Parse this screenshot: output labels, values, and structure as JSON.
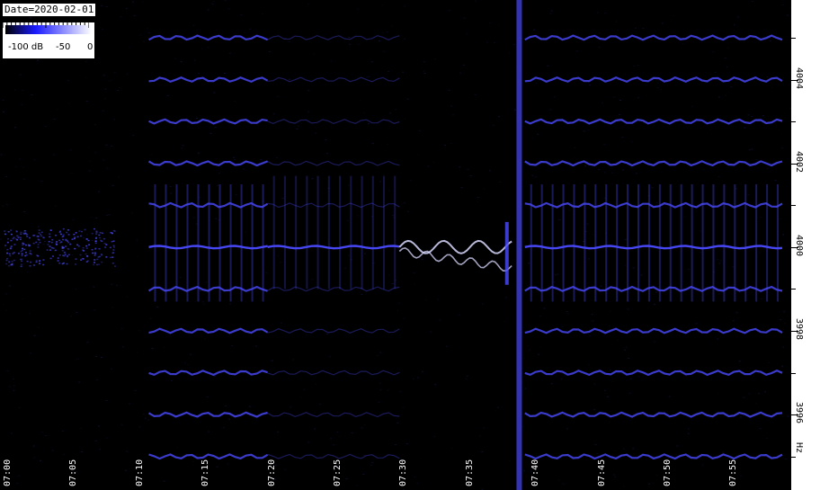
{
  "date_label": "Date=2020-02-01",
  "legend": {
    "min_label": "-100 dB",
    "mid_label": "-50",
    "max_label": "0",
    "colors": [
      "#000000",
      "#1a1aff",
      "#ffffff"
    ]
  },
  "y_unit": "Hz",
  "colors": {
    "background": "#000000",
    "signal": "#4a4aff",
    "bright": "#d8d8ff"
  },
  "chart_data": {
    "type": "heatmap",
    "title": "",
    "xlabel": "",
    "ylabel": "Hz",
    "x_ticks": [
      "07:00",
      "07:05",
      "07:10",
      "07:15",
      "07:20",
      "07:25",
      "07:30",
      "07:35",
      "07:40",
      "07:45",
      "07:50",
      "07:55"
    ],
    "y_ticks": [
      "3996",
      "3998",
      "4000",
      "4002",
      "4004"
    ],
    "xlim": [
      "07:00",
      "07:59"
    ],
    "ylim": [
      3994.2,
      4005.9
    ],
    "colorbar": {
      "min_db": -100,
      "max_db": 0,
      "ticks": [
        -100,
        -50,
        0
      ]
    },
    "carrier_hz": 4000,
    "sideband_spacing_hz": 1,
    "segments": [
      {
        "start": "07:00",
        "end": "07:08.5",
        "description": "diffuse noise around 4000 Hz",
        "sidebands": [
          0
        ]
      },
      {
        "start": "07:11",
        "end": "07:20",
        "description": "carrier with strong sidebands",
        "sidebands": [
          -5,
          -4,
          -3,
          -2,
          -1,
          0,
          1,
          2,
          3,
          4,
          5,
          6
        ]
      },
      {
        "start": "07:20",
        "end": "07:30",
        "description": "carrier with faint sidebands",
        "sidebands": [
          -5,
          -4,
          -3,
          -2,
          -1,
          0,
          1,
          2,
          3,
          4,
          5,
          6
        ]
      },
      {
        "start": "07:30",
        "end": "07:38.5",
        "description": "split bright traces near 4000 Hz",
        "sidebands": [
          0
        ]
      },
      {
        "start": "07:39.5",
        "end": "07:59",
        "description": "carrier with sidebands",
        "sidebands": [
          -5,
          -4,
          -3,
          -2,
          -1,
          0,
          1,
          2,
          3,
          4,
          5,
          6
        ]
      }
    ]
  }
}
